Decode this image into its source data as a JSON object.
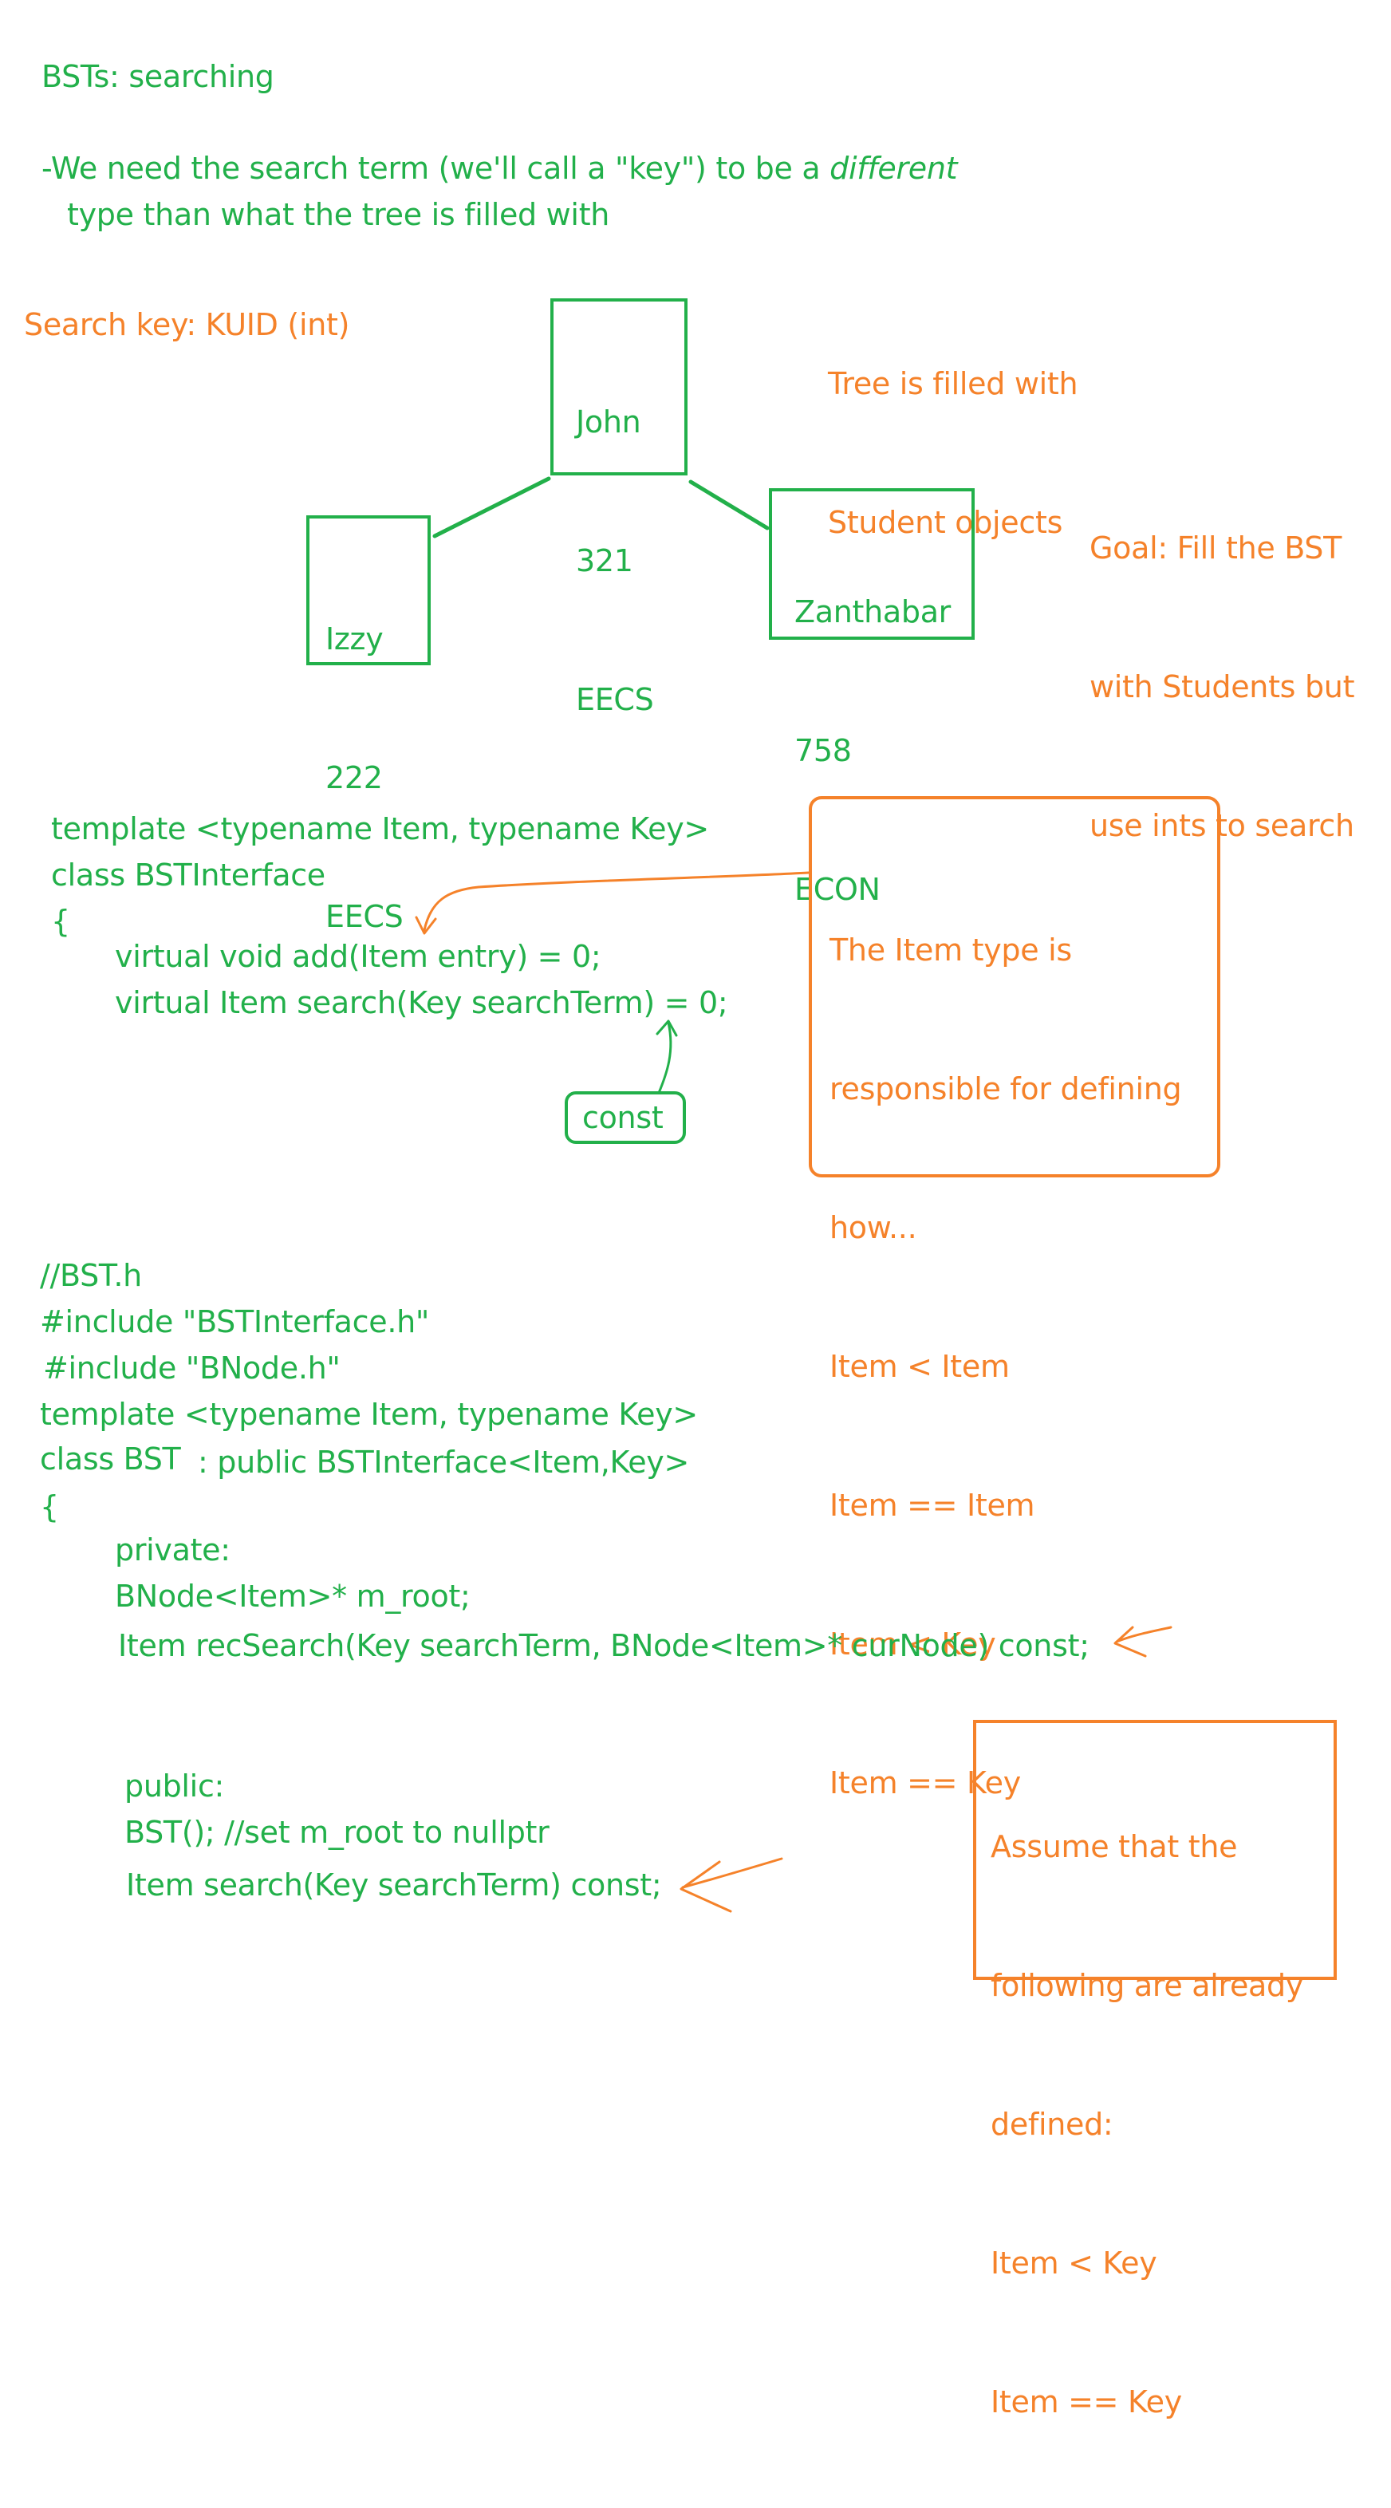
{
  "title": "BSTs: searching",
  "intro": {
    "prefix": "-We need the search term (we'll call a \"key\") to be a ",
    "emphasis": "different",
    "line2": "type than what the tree is filled with"
  },
  "search_key_note": "Search key: KUID (int)",
  "tree_note": [
    "Tree is filled with",
    "Student objects"
  ],
  "goal_note": [
    "Goal: Fill the BST",
    "with Students but",
    "use ints to search"
  ],
  "tree": {
    "root": [
      "John",
      "321",
      "EECS"
    ],
    "left": [
      "Izzy",
      "222",
      "EECS"
    ],
    "right": [
      "Zanthabar",
      "758",
      "ECON"
    ]
  },
  "interface_code": [
    "template <typename Item, typename Key>",
    "class BSTInterface",
    "{",
    "virtual void add(Item entry) = 0;",
    "virtual Item search(Key searchTerm) = 0;"
  ],
  "const_label": "const",
  "item_type_note": [
    "The Item type is",
    "responsible for defining",
    "how...",
    "Item < Item",
    "Item == Item",
    "Item < Key",
    "Item == Key"
  ],
  "bst_code": {
    "header": [
      "//BST.h",
      "#include \"BSTInterface.h\"",
      "#include \"BNode.h\"",
      "template <typename Item, typename Key>"
    ],
    "class_decl": "class BST",
    "inherit": ": public BSTInterface<Item,Key>",
    "open_brace": "{",
    "private_label": "private:",
    "root_member": "BNode<Item>* m_root;",
    "rec_search": "Item recSearch(Key searchTerm, BNode<Item>* curNode) const;",
    "public_label": "public:",
    "constructor": "BST(); //set m_root to nullptr",
    "search_decl": "Item search(Key searchTerm) const;"
  },
  "assume_note": [
    "Assume that the",
    "following are already",
    "defined:",
    "Item < Key",
    "Item == Key"
  ],
  "colors": {
    "green": "#22b04a",
    "orange": "#f5822a"
  }
}
